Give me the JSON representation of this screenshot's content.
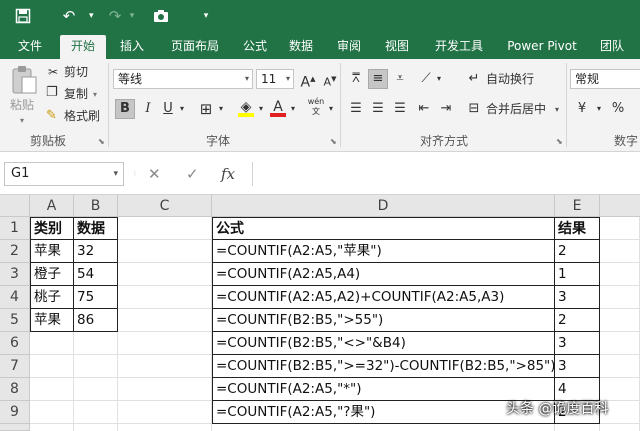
{
  "quick_access": {
    "save_icon": "save-icon",
    "undo_icon": "undo-icon",
    "redo_icon": "redo-icon",
    "camera_icon": "camera-icon",
    "customize_icon": "chevron-down-icon"
  },
  "tabs": [
    "文件",
    "开始",
    "插入",
    "页面布局",
    "公式",
    "数据",
    "审阅",
    "视图",
    "开发工具",
    "Power Pivot",
    "团队"
  ],
  "active_tab": "开始",
  "ribbon": {
    "clipboard": {
      "paste": "粘贴",
      "cut": "剪切",
      "copy": "复制",
      "format_painter": "格式刷",
      "group_label": "剪贴板"
    },
    "font": {
      "font_name": "等线",
      "font_size": "11",
      "grow": "A",
      "shrink": "A",
      "bold": "B",
      "italic": "I",
      "underline": "U",
      "font_color_glyph": "A",
      "phonetic": "wén",
      "group_label": "字体",
      "font_color": "#e02020",
      "fill_color": "#ffff00"
    },
    "alignment": {
      "wrap_text": "自动换行",
      "merge_center": "合并后居中",
      "group_label": "对齐方式"
    },
    "number": {
      "format": "常规",
      "group_label": "数字"
    }
  },
  "formula_bar": {
    "name_box": "G1",
    "cancel": "✕",
    "enter": "✓",
    "fx": "fx",
    "formula": ""
  },
  "sheet": {
    "columns": [
      "A",
      "B",
      "C",
      "D",
      "E"
    ],
    "rows": [
      "1",
      "2",
      "3",
      "4",
      "5",
      "6",
      "7",
      "8",
      "9"
    ],
    "table1": {
      "header": [
        "类别",
        "数据"
      ],
      "rows": [
        [
          "苹果",
          "32"
        ],
        [
          "橙子",
          "54"
        ],
        [
          "桃子",
          "75"
        ],
        [
          "苹果",
          "86"
        ]
      ]
    },
    "table2": {
      "header": [
        "公式",
        "结果"
      ],
      "rows": [
        [
          "=COUNTIF(A2:A5,\"苹果\")",
          "2"
        ],
        [
          "=COUNTIF(A2:A5,A4)",
          "1"
        ],
        [
          "=COUNTIF(A2:A5,A2)+COUNTIF(A2:A5,A3)",
          "3"
        ],
        [
          "=COUNTIF(B2:B5,\">55\")",
          "2"
        ],
        [
          "=COUNTIF(B2:B5,\"<>\"&B4)",
          "3"
        ],
        [
          "=COUNTIF(B2:B5,\">=32\")-COUNTIF(B2:B5,\">85\")",
          "3"
        ],
        [
          "=COUNTIF(A2:A5,\"*\")",
          "4"
        ],
        [
          "=COUNTIF(A2:A5,\"?果\")",
          "2"
        ]
      ]
    }
  },
  "watermark": "头条 @诡度百科",
  "colors": {
    "excel_green": "#217346"
  }
}
